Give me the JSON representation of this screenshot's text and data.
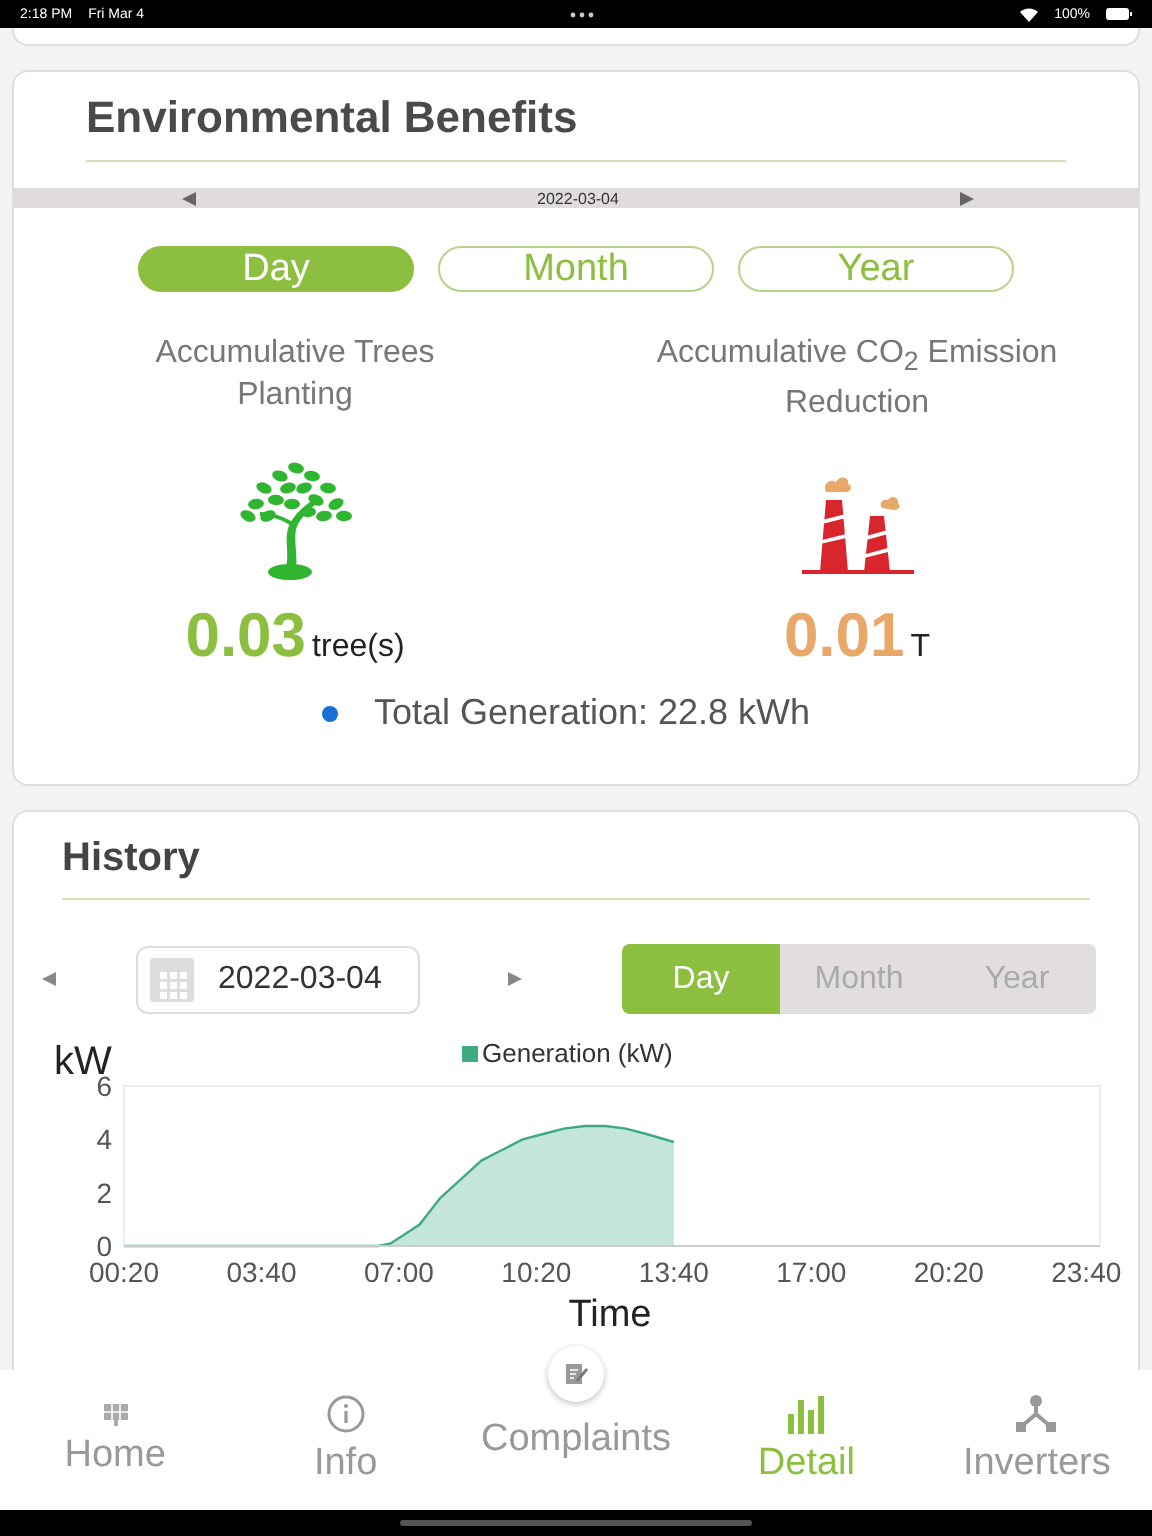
{
  "status_bar": {
    "time": "2:18 PM",
    "date": "Fri Mar 4",
    "battery": "100%"
  },
  "environmental_benefits": {
    "title": "Environmental Benefits",
    "date": "2022-03-04",
    "periods": [
      {
        "label": "Day",
        "selected": true
      },
      {
        "label": "Month",
        "selected": false
      },
      {
        "label": "Year",
        "selected": false
      }
    ],
    "stats": [
      {
        "kind": "trees",
        "label": "Accumulative Trees Planting",
        "value": "0.03",
        "unit": "tree(s)"
      },
      {
        "kind": "co2",
        "label": "Accumulative CO$_{2}$ Emission Reduction",
        "value": "0.01",
        "unit": "T"
      }
    ],
    "total": "Total Generation: 22.8 kWh"
  },
  "history": {
    "title": "History",
    "date": "2022-03-04",
    "periods": [
      {
        "label": "Day",
        "selected": true
      },
      {
        "label": "Month",
        "selected": false
      },
      {
        "label": "Year",
        "selected": false
      }
    ],
    "chart_data": {
      "type": "area",
      "xlabel": "Time",
      "ylabel": "kW",
      "x": [
        0.333,
        1,
        2,
        3,
        4,
        5,
        6,
        6.5,
        6.8,
        7,
        7.5,
        8,
        8.5,
        9,
        9.5,
        10,
        10.5,
        11,
        11.5,
        12,
        12.5,
        13,
        13.667
      ],
      "series": [
        {
          "name": "Generation (kW)",
          "color": "#3daa82",
          "values": [
            0,
            0,
            0,
            0,
            0,
            0,
            0,
            0,
            0.1,
            0.3,
            0.8,
            1.8,
            2.5,
            3.2,
            3.6,
            4.0,
            4.2,
            4.4,
            4.5,
            4.5,
            4.4,
            4.2,
            3.9
          ]
        }
      ],
      "xlim": [
        0.333,
        24
      ],
      "ylim": [
        0,
        6
      ],
      "xticks": [
        {
          "value": 0.333,
          "label": "00:20"
        },
        {
          "value": 3.667,
          "label": "03:40"
        },
        {
          "value": 7,
          "label": "07:00"
        },
        {
          "value": 10.333,
          "label": "10:20"
        },
        {
          "value": 13.667,
          "label": "13:40"
        },
        {
          "value": 17,
          "label": "17:00"
        },
        {
          "value": 20.333,
          "label": "20:20"
        },
        {
          "value": 23.667,
          "label": "23:40"
        }
      ],
      "yticks": [
        0,
        2,
        4,
        6
      ]
    }
  },
  "tab_bar": {
    "items": [
      {
        "label": "Home",
        "selected": false
      },
      {
        "label": "Info",
        "selected": false
      },
      {
        "label": "Complaints",
        "selected": false
      },
      {
        "label": "Detail",
        "selected": true
      },
      {
        "label": "Inverters",
        "selected": false
      }
    ]
  }
}
